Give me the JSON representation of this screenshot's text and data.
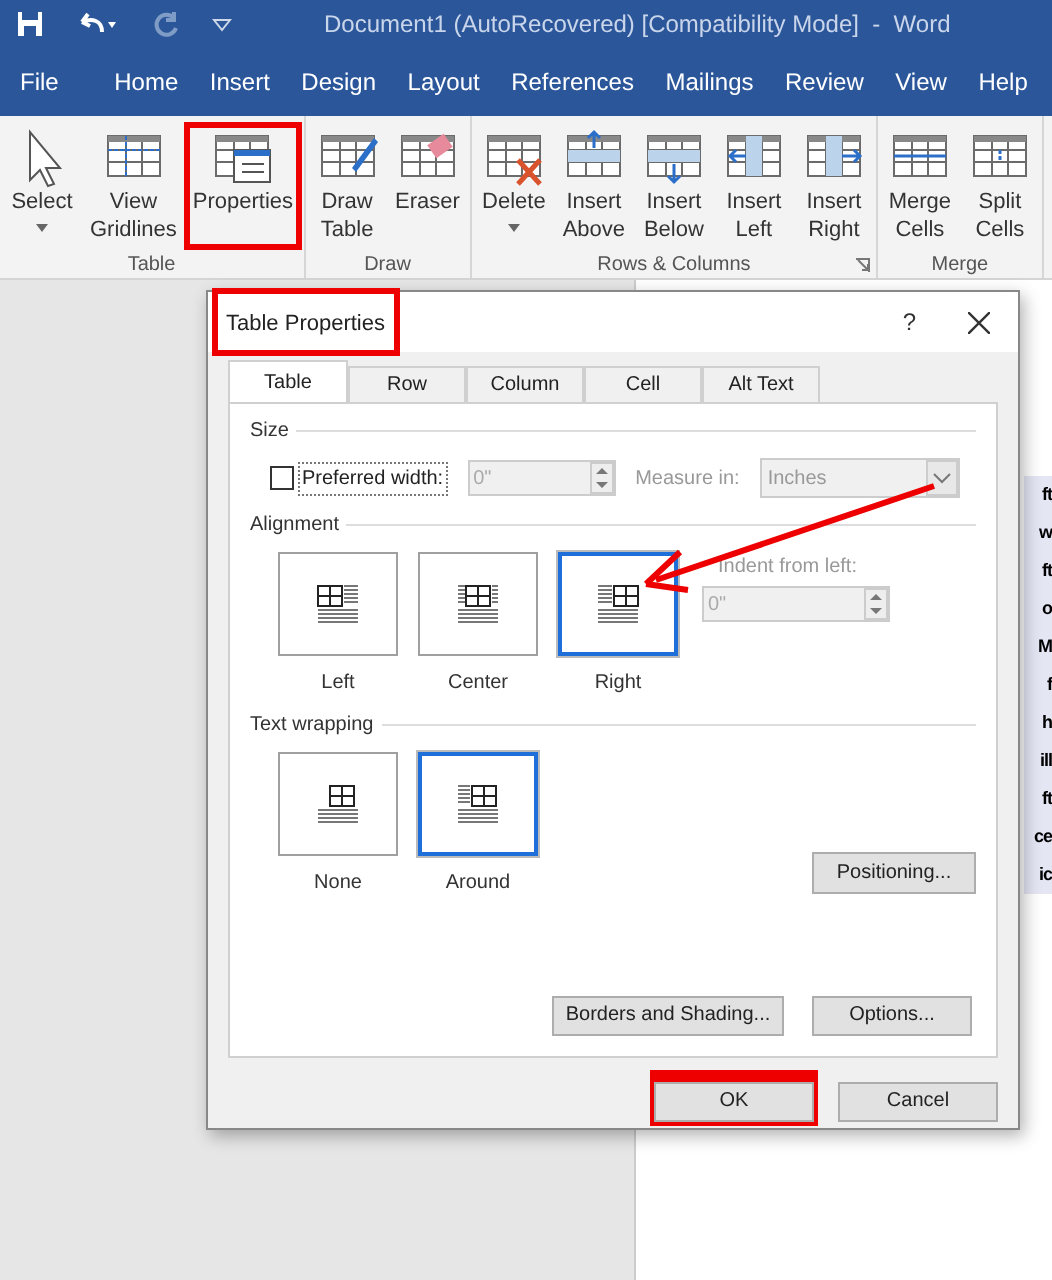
{
  "window": {
    "title": "Document1 (AutoRecovered) [Compatibility Mode]  -  Word"
  },
  "menu_tabs": [
    "File",
    "Home",
    "Insert",
    "Design",
    "Layout",
    "References",
    "Mailings",
    "Review",
    "View",
    "Help"
  ],
  "ribbon": {
    "groups": [
      {
        "label": "Table",
        "launcher": false,
        "buttons": [
          {
            "kind": "select",
            "lines": [
              "Select"
            ],
            "dropdown": true,
            "highlighted": false
          },
          {
            "kind": "gridlines",
            "lines": [
              "View",
              "Gridlines"
            ],
            "dropdown": false,
            "highlighted": false
          },
          {
            "kind": "properties",
            "lines": [
              "Properties"
            ],
            "dropdown": false,
            "highlighted": true
          }
        ]
      },
      {
        "label": "Draw",
        "launcher": false,
        "buttons": [
          {
            "kind": "draw_table",
            "lines": [
              "Draw",
              "Table"
            ],
            "dropdown": false,
            "highlighted": false
          },
          {
            "kind": "eraser",
            "lines": [
              "Eraser"
            ],
            "dropdown": false,
            "highlighted": false
          }
        ]
      },
      {
        "label": "Rows & Columns",
        "launcher": true,
        "buttons": [
          {
            "kind": "delete",
            "lines": [
              "Delete"
            ],
            "dropdown": true,
            "highlighted": false
          },
          {
            "kind": "insert_above",
            "lines": [
              "Insert",
              "Above"
            ],
            "dropdown": false,
            "highlighted": false
          },
          {
            "kind": "insert_below",
            "lines": [
              "Insert",
              "Below"
            ],
            "dropdown": false,
            "highlighted": false
          },
          {
            "kind": "insert_left",
            "lines": [
              "Insert",
              "Left"
            ],
            "dropdown": false,
            "highlighted": false
          },
          {
            "kind": "insert_right",
            "lines": [
              "Insert",
              "Right"
            ],
            "dropdown": false,
            "highlighted": false
          }
        ]
      },
      {
        "label": "Merge",
        "launcher": false,
        "buttons": [
          {
            "kind": "merge",
            "lines": [
              "Merge",
              "Cells"
            ],
            "dropdown": false,
            "highlighted": false
          },
          {
            "kind": "split",
            "lines": [
              "Split",
              "Cells"
            ],
            "dropdown": false,
            "highlighted": false
          }
        ]
      }
    ]
  },
  "document_fragments": [
    "ft",
    "w",
    "ft",
    "o",
    "M",
    "f",
    "h",
    "ill",
    "ft",
    "ce",
    "ic"
  ],
  "dialog": {
    "title": "Table Properties",
    "title_highlighted": true,
    "help": "?",
    "tabs": [
      {
        "label": "Table",
        "selected": true
      },
      {
        "label": "Row",
        "selected": false
      },
      {
        "label": "Column",
        "selected": false
      },
      {
        "label": "Cell",
        "selected": false
      },
      {
        "label": "Alt Text",
        "selected": false
      }
    ],
    "size": {
      "heading": "Size",
      "checkbox_label": "Preferred width:",
      "checked": false,
      "width_value": "0\"",
      "measure_label": "Measure in:",
      "measure_value": "Inches"
    },
    "alignment": {
      "heading": "Alignment",
      "options": [
        {
          "kind": "left",
          "label": "Left",
          "selected": false
        },
        {
          "kind": "center",
          "label": "Center",
          "selected": false
        },
        {
          "kind": "right",
          "label": "Right",
          "selected": true
        }
      ],
      "indent_label": "Indent from left:",
      "indent_value": "0\""
    },
    "wrapping": {
      "heading": "Text wrapping",
      "options": [
        {
          "kind": "none",
          "label": "None",
          "selected": false
        },
        {
          "kind": "around",
          "label": "Around",
          "selected": true
        }
      ],
      "positioning": "Positioning..."
    },
    "buttons": [
      {
        "label": "Borders and Shading...",
        "highlighted": false
      },
      {
        "label": "Options...",
        "highlighted": false
      }
    ],
    "footer_buttons": [
      {
        "label": "OK",
        "highlighted": true
      },
      {
        "label": "Cancel",
        "highlighted": false
      }
    ]
  }
}
